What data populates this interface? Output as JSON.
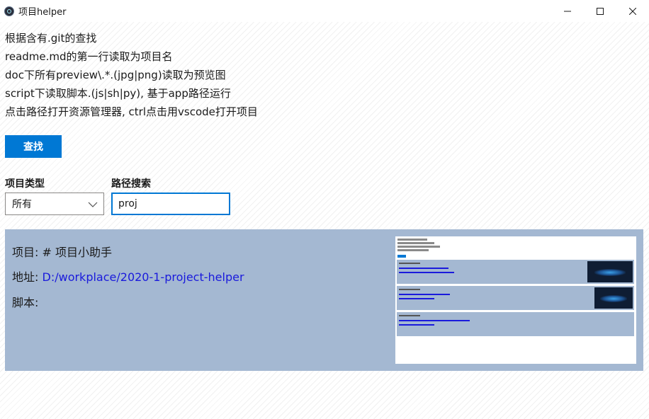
{
  "window": {
    "title": "项目helper",
    "app_icon": "electron-icon",
    "controls": [
      "minimize-icon",
      "maximize-icon",
      "close-icon"
    ]
  },
  "intro": [
    "根据含有.git的查找",
    "readme.md的第一行读取为项目名",
    "doc下所有preview\\.*.(jpg|png)读取为预览图",
    "script下读取脚本.(js|sh|py), 基于app路径运行",
    "点击路径打开资源管理器, ctrl点击用vscode打开项目"
  ],
  "search_button": {
    "label": "查找",
    "color": "#0078d4"
  },
  "filters": {
    "type_label": "项目类型",
    "type_value": "所有",
    "path_label": "路径搜索",
    "path_value": "proj"
  },
  "result": {
    "project_label": "项目:",
    "project_name": "# 项目小助手",
    "address_label": "地址:",
    "address": "D:/workplace/2020-1-project-helper",
    "scripts_label": "脚本:",
    "background": "#a4b8d2",
    "link_color": "#1a1adc"
  },
  "accent_color": "#0078d4"
}
